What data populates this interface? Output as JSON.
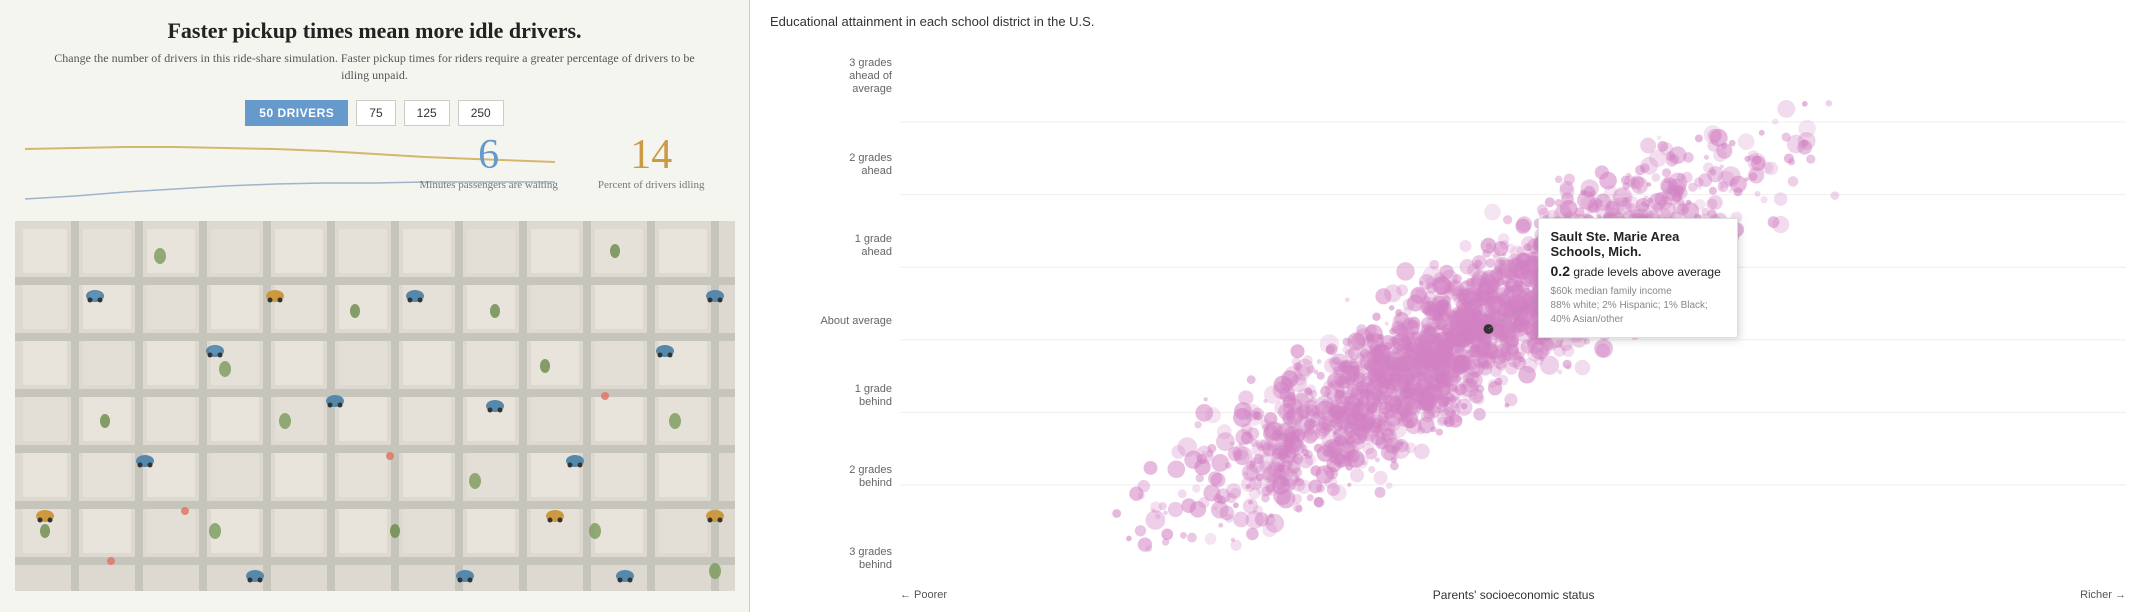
{
  "left": {
    "title": "Faster pickup times mean more idle drivers.",
    "subtitle": "Change the number of drivers in this ride-share simulation. Faster pickup times for riders require a greater percentage of drivers to be idling unpaid.",
    "buttons": [
      {
        "label": "50 DRIVERS",
        "selected": true
      },
      {
        "label": "75",
        "selected": false
      },
      {
        "label": "125",
        "selected": false
      },
      {
        "label": "250",
        "selected": false
      }
    ],
    "stat1_num": "6",
    "stat1_label": "Minutes passengers are waiting",
    "stat2_num": "14",
    "stat2_label": "Percent of drivers idling"
  },
  "right": {
    "title": "Educational attainment in each school district in the U.S.",
    "y_labels": [
      {
        "text": "3 grades ahead of average"
      },
      {
        "text": "2 grades ahead"
      },
      {
        "text": "1 grade ahead"
      },
      {
        "text": "About average"
      },
      {
        "text": "1 grade behind"
      },
      {
        "text": "2 grades behind"
      },
      {
        "text": "3 grades behind"
      }
    ],
    "x_left": "← Poorer",
    "x_center": "Parents' socioeconomic status",
    "x_right": "Richer →",
    "tooltip": {
      "title": "Sault Ste. Marie Area Schools, Mich.",
      "grade_text": "0.2 grade levels above average",
      "grade_num": "0.2",
      "detail1": "$60k median family income",
      "detail2": "88% white; 2% Hispanic; 1% Black; 40% Asian/other"
    }
  }
}
